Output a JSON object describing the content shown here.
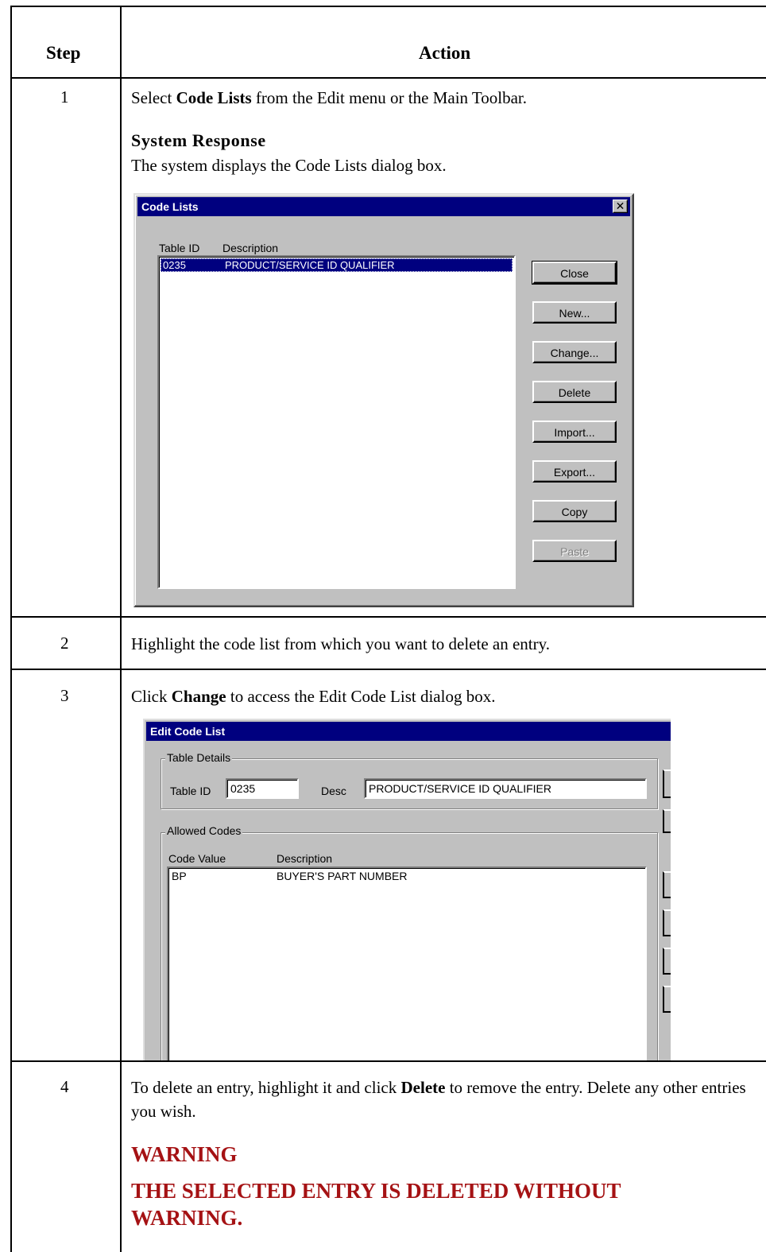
{
  "table": {
    "headers": {
      "step": "Step",
      "action": "Action"
    },
    "rows": [
      {
        "step": "1",
        "text_pre": "Select ",
        "text_bold": "Code Lists",
        "text_post": " from the Edit menu or the Main Toolbar.",
        "system_response_label": "System Response",
        "system_response_text": "The system displays the Code Lists dialog box."
      },
      {
        "step": "2",
        "text": "Highlight the code list from which you want to delete an entry."
      },
      {
        "step": "3",
        "text_pre": "Click ",
        "text_bold": "Change",
        "text_post": " to access the Edit Code List dialog box."
      },
      {
        "step": "4",
        "text_pre": "To delete an entry, highlight it and click ",
        "text_bold": "Delete",
        "text_post": " to remove the entry. Delete any other entries you wish.",
        "warning_title": "WARNING",
        "warning_text": "THE SELECTED ENTRY IS DELETED WITHOUT WARNING."
      }
    ]
  },
  "code_lists_dialog": {
    "title": "Code Lists",
    "close_glyph": "✕",
    "col_table_id": "Table ID",
    "col_description": "Description",
    "selected_row": {
      "table_id": "0235",
      "description": "PRODUCT/SERVICE ID QUALIFIER"
    },
    "buttons": {
      "close": "Close",
      "new": "New...",
      "change": "Change...",
      "delete": "Delete",
      "import": "Import...",
      "export": "Export...",
      "copy": "Copy",
      "paste": "Paste"
    }
  },
  "edit_code_list_dialog": {
    "title": "Edit Code List",
    "table_details_label": "Table Details",
    "table_id_label": "Table ID",
    "table_id_value": "0235",
    "desc_label": "Desc",
    "desc_value": "PRODUCT/SERVICE ID QUALIFIER",
    "allowed_codes_label": "Allowed Codes",
    "col_code_value": "Code Value",
    "col_description": "Description",
    "rows": [
      {
        "code": "BP",
        "description": "BUYER'S PART NUMBER"
      }
    ]
  },
  "colors": {
    "titlebar": "#00007f",
    "dialog_face": "#c0c0c0",
    "warning": "#a51214"
  }
}
